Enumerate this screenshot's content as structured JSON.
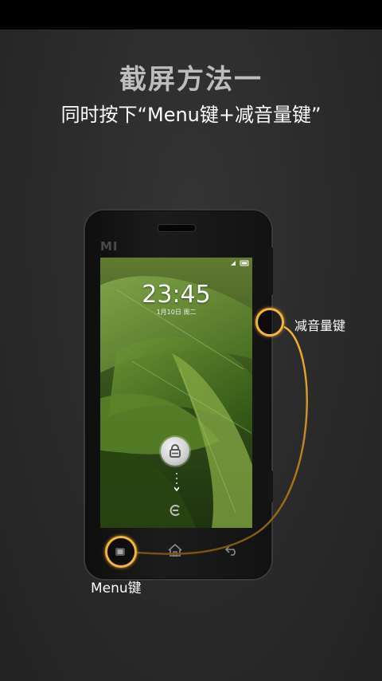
{
  "heading": {
    "title": "截屏方法一",
    "subtitle": "同时按下“Menu键+减音量键”"
  },
  "phone": {
    "brand": "MI",
    "lockscreen": {
      "time": "23:45",
      "date": "1月10日 周二"
    }
  },
  "callouts": {
    "volume_down_label": "减音量键",
    "menu_label": "Menu键"
  },
  "colors": {
    "highlight": "#f2b73a",
    "title": "#bdbdbd",
    "background": "#2a2a2a"
  },
  "icons": {
    "lock": "unlock-icon",
    "camera": "camera-icon",
    "menu": "menu-icon",
    "home": "home-icon",
    "back": "back-icon"
  }
}
